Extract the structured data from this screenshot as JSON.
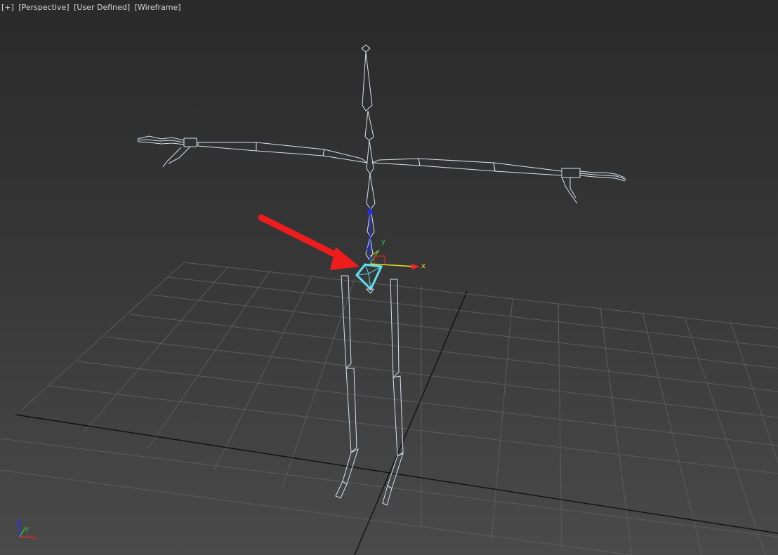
{
  "viewport": {
    "labels": [
      "[+]",
      "[Perspective]",
      "[User Defined]",
      "[Wireframe]"
    ]
  },
  "gizmo": {
    "x_label": "x",
    "y_label": "y",
    "z_label": "z"
  },
  "axis_tripod": {
    "x_label": "x",
    "y_label": "y",
    "z_label": "z"
  },
  "colors": {
    "background_top": "#2a2a2a",
    "grid": "#5c5c5c",
    "grid_main_axis": "#111111",
    "bone_wire": "#d6e2ee",
    "selected_bone": "#5fe0f0",
    "annotation_arrow": "#ee1c1c",
    "gizmo_x": "#ff2020",
    "gizmo_y": "#30c030",
    "gizmo_z": "#2030ff",
    "gizmo_yellow": "#f0e020"
  }
}
